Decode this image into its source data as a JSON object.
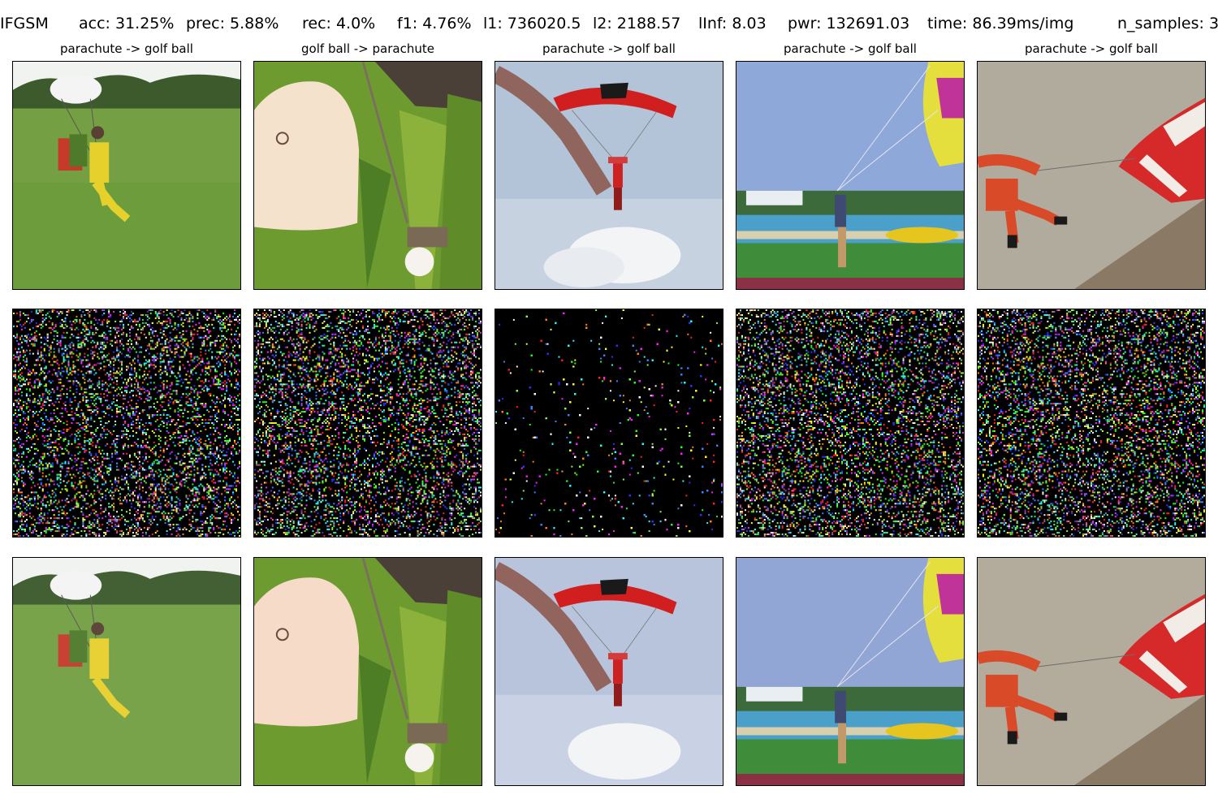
{
  "header": {
    "method": "IFGSM",
    "acc": "acc: 31.25%",
    "prec": "prec: 5.88%",
    "rec": "rec: 4.0%",
    "f1": "f1: 4.76%",
    "l1": "l1: 736020.5",
    "l2": "l2: 2188.57",
    "linf": "lInf: 8.03",
    "pwr": "pwr: 132691.03",
    "time": "time: 86.39ms/img",
    "n_samples": "n_samples: 3"
  },
  "columns": [
    {
      "title": "parachute -> golf ball",
      "subject": "tandem-skydivers-on-grass"
    },
    {
      "title": "golf ball -> parachute",
      "subject": "cap-in-grass-with-golf-ball"
    },
    {
      "title": "parachute -> golf ball",
      "subject": "skydiver-with-smoke-trail"
    },
    {
      "title": "parachute -> golf ball",
      "subject": "parasailer-at-beach"
    },
    {
      "title": "parachute -> golf ball",
      "subject": "skydiver-with-red-canopy"
    }
  ],
  "rows": [
    {
      "role": "original-image"
    },
    {
      "role": "perturbation-noise"
    },
    {
      "role": "adversarial-image"
    }
  ]
}
